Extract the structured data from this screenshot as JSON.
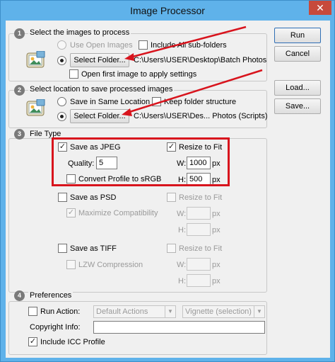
{
  "window": {
    "title": "Image Processor",
    "close_glyph": "✕"
  },
  "buttons": {
    "run": "Run",
    "cancel": "Cancel",
    "load": "Load...",
    "save": "Save..."
  },
  "section1": {
    "number": "1",
    "title": "Select the images to process",
    "use_open_images": "Use Open Images",
    "include_subfolders": "Include All sub-folders",
    "select_folder": "Select Folder...",
    "folder_path": "C:\\Users\\USER\\Desktop\\Batch Photos",
    "open_first_image": "Open first image to apply settings",
    "icon": "photoshop-image-icon"
  },
  "section2": {
    "number": "2",
    "title": "Select location to save processed images",
    "save_same_location": "Save in Same Location",
    "keep_folder_structure": "Keep folder structure",
    "select_folder": "Select Folder...",
    "folder_path": "C:\\Users\\USER\\Des... Photos (Scripts)",
    "icon": "photoshop-image-icon"
  },
  "section3": {
    "number": "3",
    "title": "File Type",
    "jpeg": {
      "save_as": "Save as JPEG",
      "checked": true,
      "resize": "Resize to Fit",
      "resize_checked": true,
      "quality_label": "Quality:",
      "quality_value": "5",
      "w_label": "W:",
      "w_value": "1000",
      "w_unit": "px",
      "h_label": "H:",
      "h_value": "500",
      "h_unit": "px",
      "convert_srgb": "Convert Profile to sRGB",
      "convert_checked": false
    },
    "psd": {
      "save_as": "Save as PSD",
      "checked": false,
      "resize": "Resize to Fit",
      "maximize": "Maximize Compatibility",
      "w_label": "W:",
      "w_unit": "px",
      "h_label": "H:",
      "h_unit": "px"
    },
    "tiff": {
      "save_as": "Save as TIFF",
      "checked": false,
      "resize": "Resize to Fit",
      "lzw": "LZW Compression",
      "w_label": "W:",
      "w_unit": "px",
      "h_label": "H:",
      "h_unit": "px"
    }
  },
  "section4": {
    "number": "4",
    "title": "Preferences",
    "run_action": "Run Action:",
    "action_set": "Default Actions",
    "action": "Vignette (selection)",
    "copyright_label": "Copyright Info:",
    "copyright_value": "",
    "include_icc": "Include ICC Profile",
    "include_icc_checked": true
  },
  "colors": {
    "annotation_red": "#d8141d",
    "titlebar_blue": "#5fb2ea"
  }
}
